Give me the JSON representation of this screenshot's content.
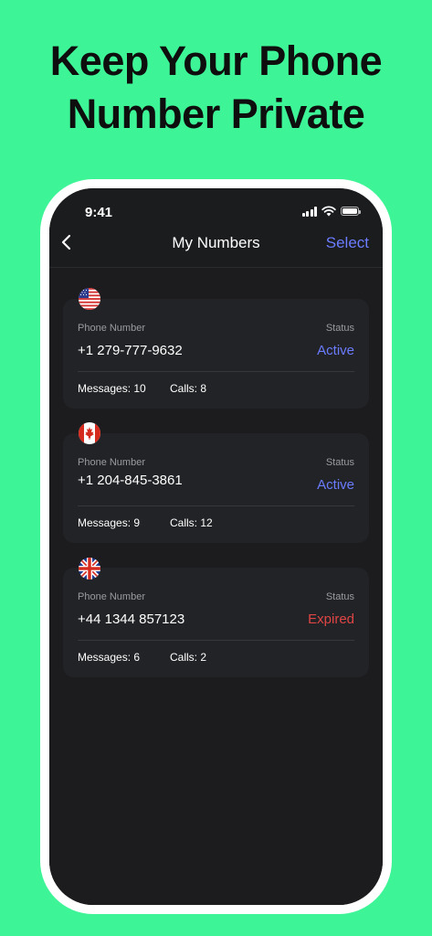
{
  "headline": {
    "line1": "Keep Your Phone",
    "line2": "Number Private"
  },
  "status_bar": {
    "time": "9:41",
    "icons": [
      "cellular-signal-icon",
      "wifi-icon",
      "battery-icon"
    ]
  },
  "nav": {
    "back_icon": "chevron-left-icon",
    "title": "My Numbers",
    "action": "Select"
  },
  "labels": {
    "phone_number": "Phone Number",
    "status": "Status"
  },
  "numbers": [
    {
      "flag": "us-flag-icon",
      "number": "+1 279-777-9632",
      "status": "Active",
      "status_color": "#6b7cff",
      "messages": "Messages: 10",
      "calls": "Calls: 8"
    },
    {
      "flag": "canada-flag-icon",
      "number": "+1 204-845-3861",
      "status": "Active",
      "status_color": "#6b7cff",
      "messages": "Messages: 9",
      "calls": "Calls: 12"
    },
    {
      "flag": "uk-flag-icon",
      "number": "+44 1344 857123",
      "status": "Expired",
      "status_color": "#e04545",
      "messages": "Messages: 6",
      "calls": "Calls: 2"
    }
  ],
  "colors": {
    "background": "#3df596",
    "accent": "#6b7cff",
    "expired": "#e04545",
    "screen": "#1c1c1e",
    "card": "#222326"
  }
}
